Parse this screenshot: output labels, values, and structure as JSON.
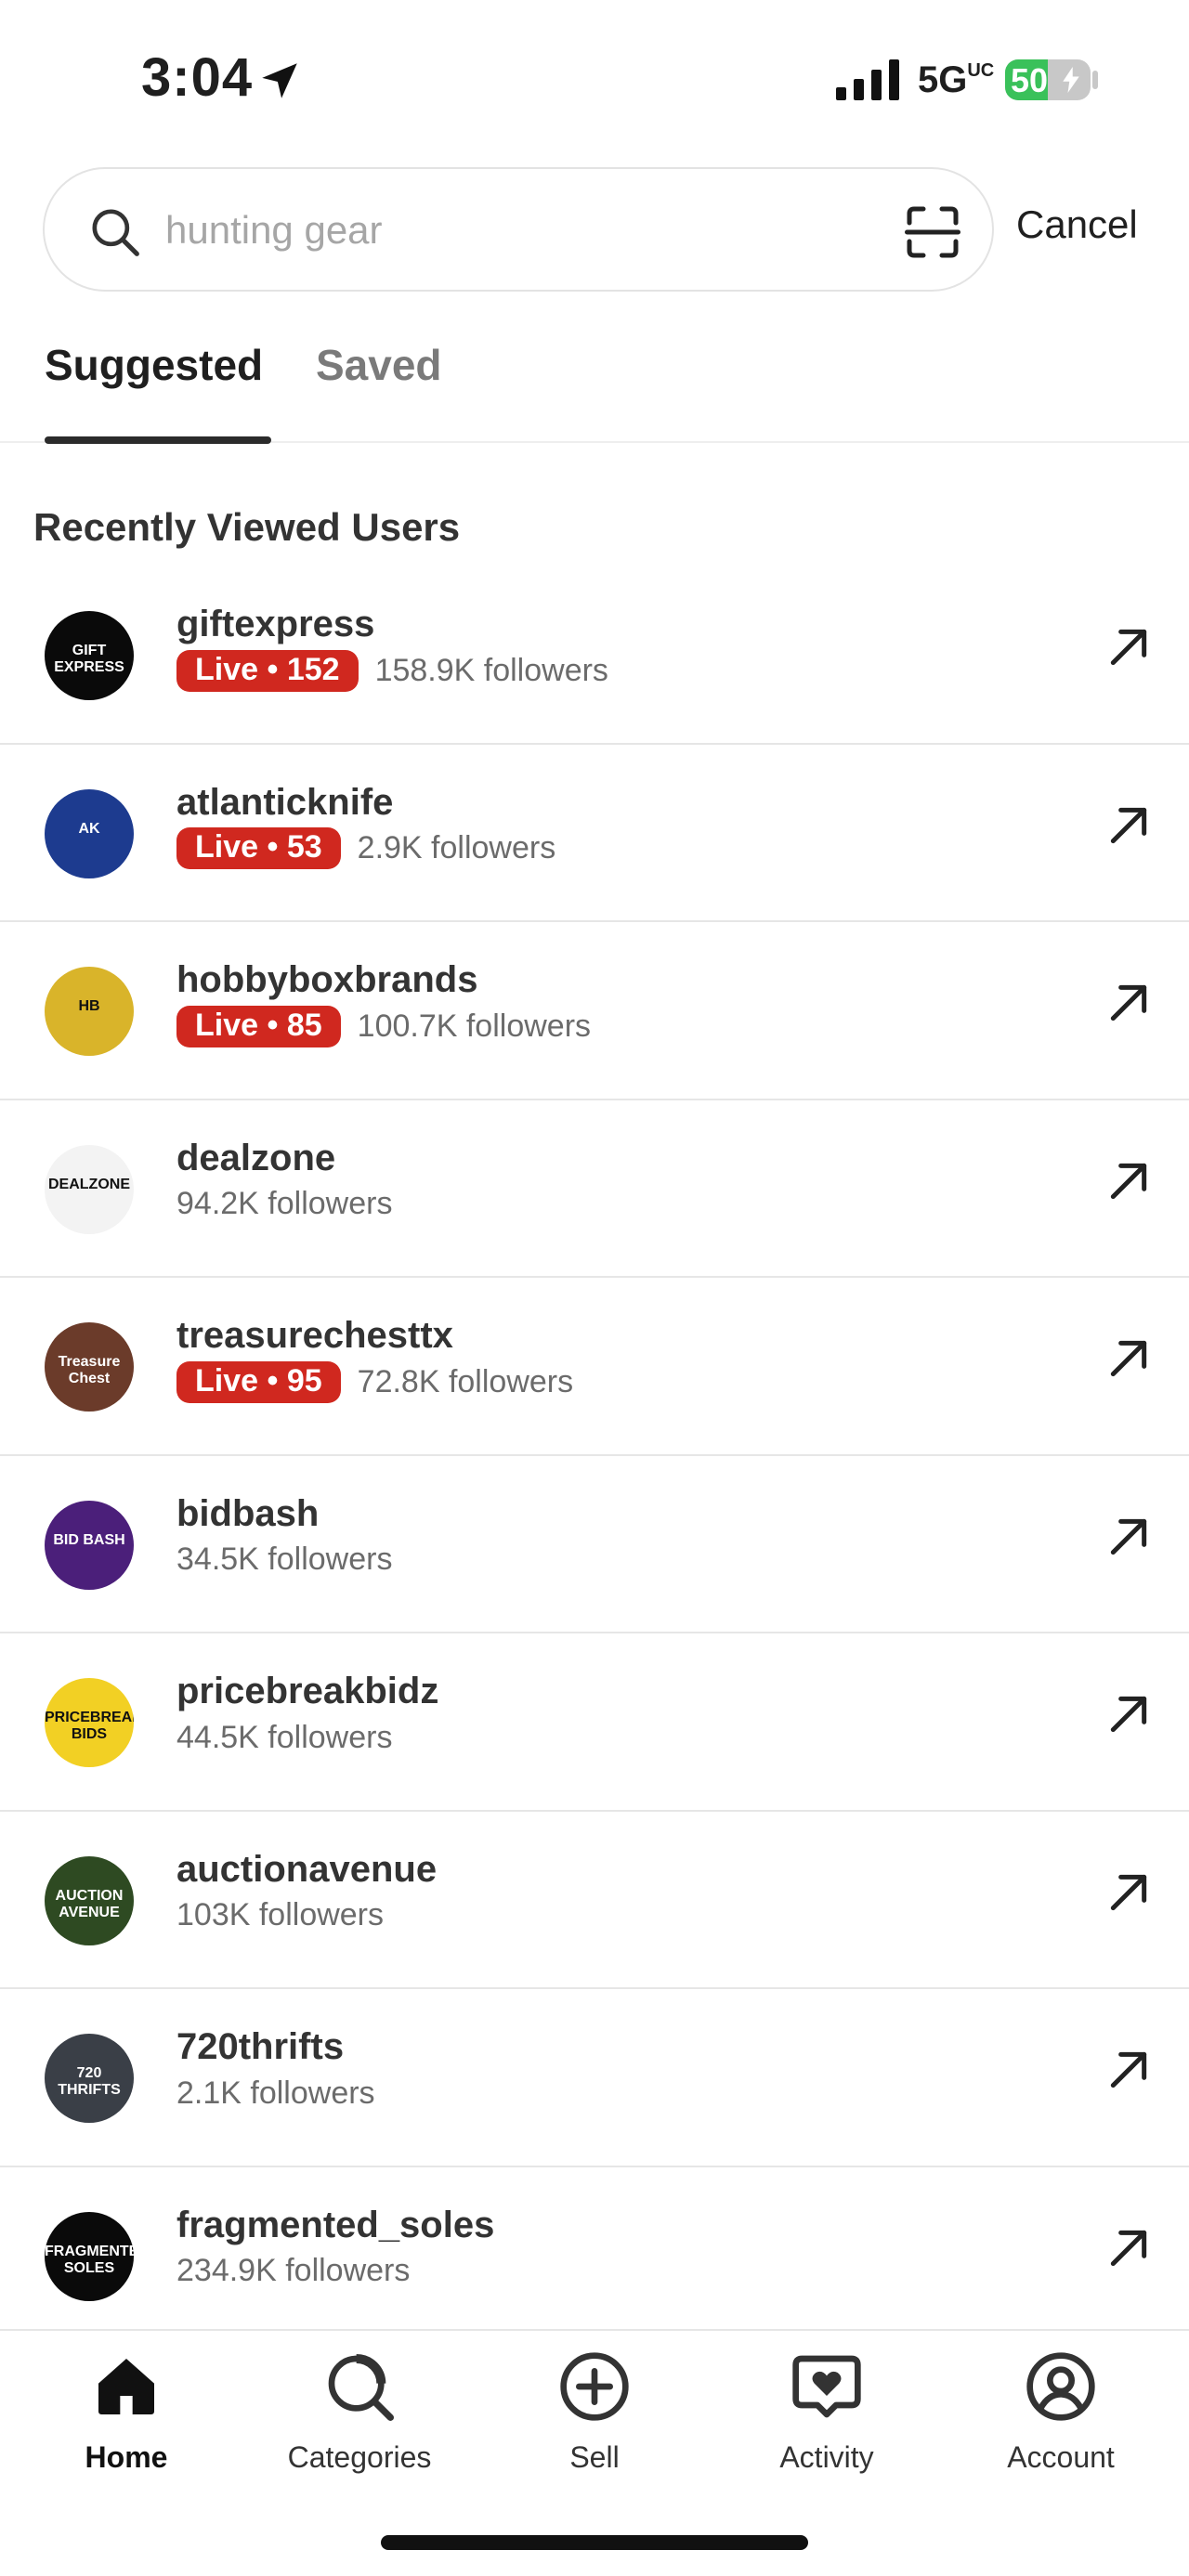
{
  "status_bar": {
    "time": "3:04",
    "network": "5G",
    "network_suffix": "UC",
    "battery": "50",
    "battery_fraction": 0.5
  },
  "search": {
    "placeholder": "hunting gear",
    "cancel_label": "Cancel"
  },
  "tabs": [
    {
      "label": "Suggested",
      "active": true
    },
    {
      "label": "Saved",
      "active": false
    }
  ],
  "section_title": "Recently Viewed Users",
  "users": [
    {
      "username": "giftexpress",
      "live": "Live • 152",
      "followers": "158.9K followers",
      "avatar_text": "GIFT EXPRESS",
      "avatar_color": "#0a0a0a"
    },
    {
      "username": "atlanticknife",
      "live": "Live • 53",
      "followers": "2.9K followers",
      "avatar_text": "AK",
      "avatar_color": "#1d3b8f"
    },
    {
      "username": "hobbyboxbrands",
      "live": "Live • 85",
      "followers": "100.7K followers",
      "avatar_text": "HB",
      "avatar_color": "#d9b42a"
    },
    {
      "username": "dealzone",
      "live": "",
      "followers": "94.2K followers",
      "avatar_text": "DEALZONE",
      "avatar_color": "#f3f3f3"
    },
    {
      "username": "treasurechesttx",
      "live": "Live • 95",
      "followers": "72.8K followers",
      "avatar_text": "Treasure Chest",
      "avatar_color": "#6b3b2a"
    },
    {
      "username": "bidbash",
      "live": "",
      "followers": "34.5K followers",
      "avatar_text": "BID BASH",
      "avatar_color": "#4b1f7a"
    },
    {
      "username": "pricebreakbidz",
      "live": "",
      "followers": "44.5K followers",
      "avatar_text": "PRICEBREAK BIDS",
      "avatar_color": "#f2d024"
    },
    {
      "username": "auctionavenue",
      "live": "",
      "followers": "103K followers",
      "avatar_text": "AUCTION AVENUE",
      "avatar_color": "#2e4a22"
    },
    {
      "username": "720thrifts",
      "live": "",
      "followers": "2.1K followers",
      "avatar_text": "720 THRIFTS",
      "avatar_color": "#3a3f47"
    },
    {
      "username": "fragmented_soles",
      "live": "",
      "followers": "234.9K followers",
      "avatar_text": "FRAGMENTED SOLES",
      "avatar_color": "#0a0a0a"
    }
  ],
  "nav": [
    {
      "label": "Home",
      "icon": "home-icon",
      "active": true
    },
    {
      "label": "Categories",
      "icon": "categories-icon",
      "active": false
    },
    {
      "label": "Sell",
      "icon": "sell-plus-icon",
      "active": false
    },
    {
      "label": "Activity",
      "icon": "activity-heart-icon",
      "active": false
    },
    {
      "label": "Account",
      "icon": "account-icon",
      "active": false
    }
  ],
  "colors": {
    "live_badge": "#d0281f",
    "battery_green": "#3ac15a"
  }
}
